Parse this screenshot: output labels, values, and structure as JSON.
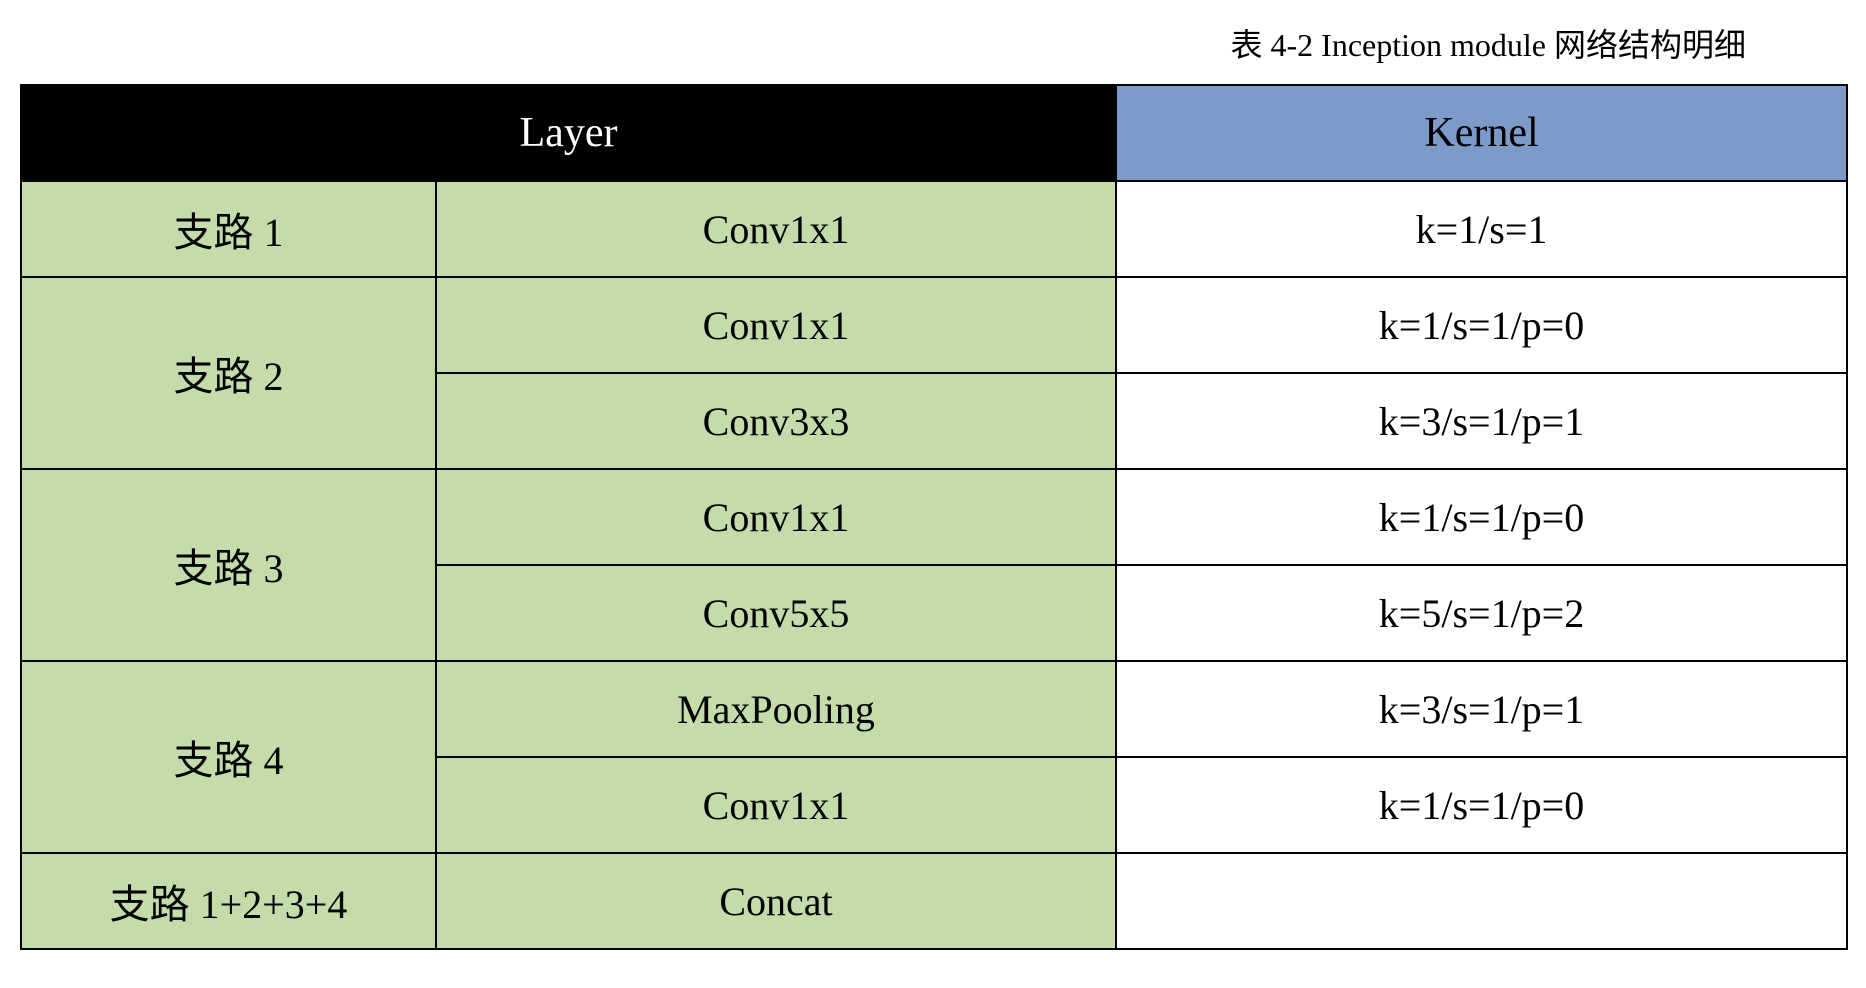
{
  "caption": "表 4-2 Inception module 网络结构明细",
  "headers": {
    "layer": "Layer",
    "kernel": "Kernel"
  },
  "rows": [
    {
      "branch": "支路 1",
      "layer": "Conv1x1",
      "kernel": "k=1/s=1"
    },
    {
      "branch": "支路 2",
      "layer": "Conv1x1",
      "kernel": "k=1/s=1/p=0"
    },
    {
      "branch": "",
      "layer": "Conv3x3",
      "kernel": "k=3/s=1/p=1"
    },
    {
      "branch": "支路 3",
      "layer": "Conv1x1",
      "kernel": "k=1/s=1/p=0"
    },
    {
      "branch": "",
      "layer": "Conv5x5",
      "kernel": "k=5/s=1/p=2"
    },
    {
      "branch": "支路 4",
      "layer": "MaxPooling",
      "kernel": "k=3/s=1/p=1"
    },
    {
      "branch": "",
      "layer": "Conv1x1",
      "kernel": "k=1/s=1/p=0"
    },
    {
      "branch": "支路 1+2+3+4",
      "layer": "Concat",
      "kernel": ""
    }
  ]
}
